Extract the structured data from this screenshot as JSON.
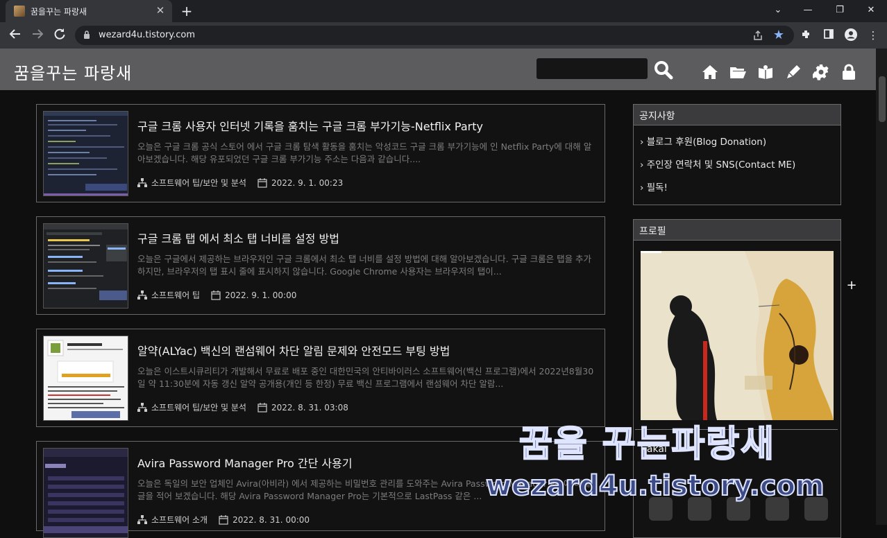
{
  "browser": {
    "tab_title": "꿈을꾸는 파랑새",
    "url": "wezard4u.tistory.com",
    "accent_color": "#8ab4f8"
  },
  "header": {
    "blog_title": "꿈을꾸는 파랑새",
    "search_placeholder": "",
    "icons": [
      "search-icon",
      "home-icon",
      "folder-icon",
      "guestbook-icon",
      "write-icon",
      "settings-icon",
      "lock-icon"
    ]
  },
  "posts": [
    {
      "title": "구글 크롬 사용자 인터넷 기록을 훔치는 구글 크롬 부가기능-Netflix Party",
      "excerpt": "오늘은 구글 크롬 공식 스토어 에서 구글 크롬 탐색 활동을 훔치는 악성코드 구글 크롬 부가기능에 인 Netflix Party에 대해 알아보겠습니다. 해당 유포되었던 구글 크롬 부가기능 주소는 다음과 같습니다....",
      "category": "소프트웨어 팁/보안 및 분석",
      "date": "2022. 9. 1. 00:23"
    },
    {
      "title": "구글 크롬 탭 에서 최소 탭 너비를 설정 방법",
      "excerpt": "오늘은 구글에서 제공하는 브라우저인 구글 크롬에서 최소 탭 너비를 설정 방법에 대해 알아보겠습니다. 구글 크롬은 탭을 추가하지만, 브라우저의 탭 표시 줄에 표시하지 않습니다. Google Chrome 사용자는 브라우저의 탭이...",
      "category": "소프트웨어 팁",
      "date": "2022. 9. 1. 00:00"
    },
    {
      "title": "알약(ALYac) 백신의 랜섬웨어 차단 알림 문제와 안전모드 부팅 방법",
      "excerpt": "오늘은 이스트시큐리티가 개발해서 무료로 배포 중인 대한민국의 안티바이러스 소프트웨어(백신 프로그램)에서 2022년8월30일 약 11:30분에 자동 갱신 알약 공개용(개인 등 한정) 무료 백신 프로그램에서 랜섬웨어 차단 알람...",
      "category": "소프트웨어 팁/보안 및 분석",
      "date": "2022. 8. 31. 03:08"
    },
    {
      "title": "Avira Password Manager Pro 간단 사용기",
      "excerpt": "오늘은 독일의 보안 업체인 Avira(아비라) 에서 제공하는 비밀번호 관리를 도와주는 Avira Password Manager Pro에 대해 글을 적어 보겠습니다. 해당 Avira Password Manager Pro는 기본적으로 LastPass 같은 ...",
      "category": "소프트웨어 소개",
      "date": "2022. 8. 31. 00:00"
    }
  ],
  "sidebar": {
    "notice_title": "공지사항",
    "notices": [
      "› 블로그 후원(Blog Donation)",
      "› 주인장 연락처 및 SNS(Contact ME)",
      "› 필독!"
    ],
    "profile_title": "프로필",
    "profile_name": "Sakai",
    "social_icons": [
      "facebook-icon",
      "twitter-icon",
      "instagram-icon",
      "kakao-icon",
      "email-icon"
    ]
  },
  "watermark": {
    "line1": "꿈을 꾸는파랑새",
    "line2": "wezard4u.tistory.com"
  }
}
